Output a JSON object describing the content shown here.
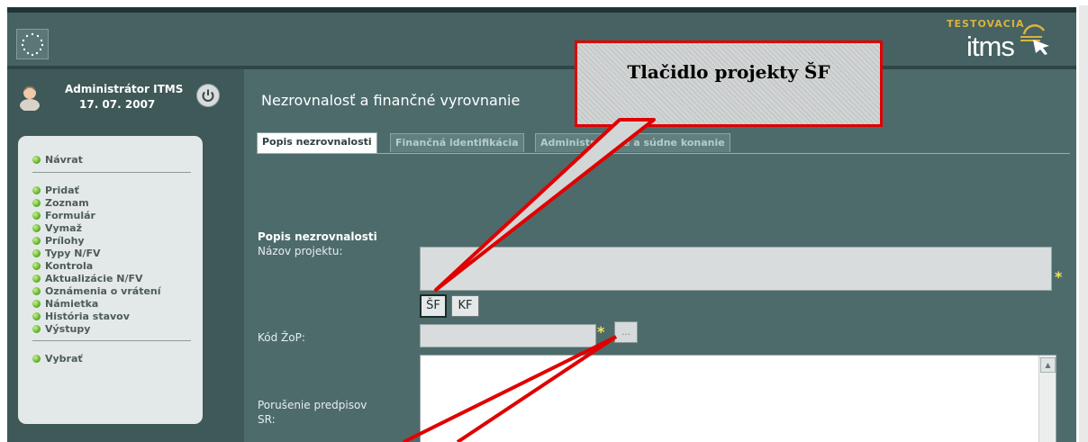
{
  "brand": {
    "badge": "TESTOVACIA",
    "logo_text": "itms"
  },
  "user": {
    "name": "Administrátor ITMS",
    "date": "17. 07. 2007"
  },
  "sidebar": {
    "items": [
      {
        "label": "Návrat"
      },
      {
        "label": "Pridať"
      },
      {
        "label": "Zoznam"
      },
      {
        "label": "Formulár"
      },
      {
        "label": "Vymaž"
      },
      {
        "label": "Prílohy"
      },
      {
        "label": "Typy N/FV"
      },
      {
        "label": "Kontrola"
      },
      {
        "label": "Aktualizácie N/FV"
      },
      {
        "label": "Oznámenia o vrátení"
      },
      {
        "label": "Námietka"
      },
      {
        "label": "História stavov"
      },
      {
        "label": "Výstupy"
      },
      {
        "label": "Vybrať"
      }
    ]
  },
  "main": {
    "title": "Nezrovnalosť a finančné vyrovnanie",
    "tabs": [
      {
        "label": "Popis nezrovnalosti"
      },
      {
        "label": "Finančná identifikácia"
      },
      {
        "label": "Administratívne a súdne konanie"
      }
    ],
    "section_title": "Popis nezrovnalosti",
    "fields": {
      "project_name_label": "Názov projektu:",
      "zop_code_label": "Kód ŽoP:",
      "sr_violation_label_line1": "Porušenie predpisov",
      "sr_violation_label_line2": "SR:",
      "required_mark": "*",
      "dots_label": "..."
    },
    "buttons": {
      "sf": "ŠF",
      "kf": "KF"
    }
  },
  "callout": {
    "text": "Tlačidlo projekty ŠF"
  },
  "colors": {
    "callout_border": "#e00000",
    "required_star": "#f2e35a",
    "menu_dot": "#5cae2a"
  }
}
